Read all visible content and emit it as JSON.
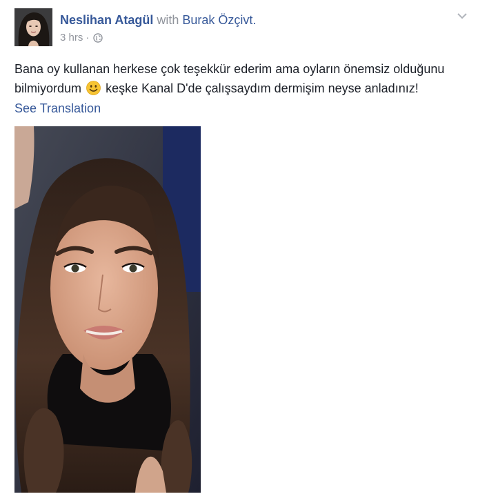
{
  "post": {
    "author": "Neslihan Atagül",
    "with_label": "with",
    "tagged_user": "Burak Özçivt.",
    "timestamp": "3 hrs",
    "separator": "·",
    "privacy_icon": "globe-icon",
    "text_part1": "Bana oy kullanan herkese çok teşekkür ederim ama oyların önemsiz olduğunu bilmiyordum",
    "emoji_icon": "smile-emoji-icon",
    "text_part2": "keşke Kanal D'de çalışsaydım dermişim neyse anladınız!",
    "see_translation": "See Translation",
    "menu_icon": "chevron-down-icon"
  },
  "colors": {
    "link": "#365899",
    "meta": "#90949c",
    "text": "#1d2129",
    "emoji": "#f7c433"
  }
}
